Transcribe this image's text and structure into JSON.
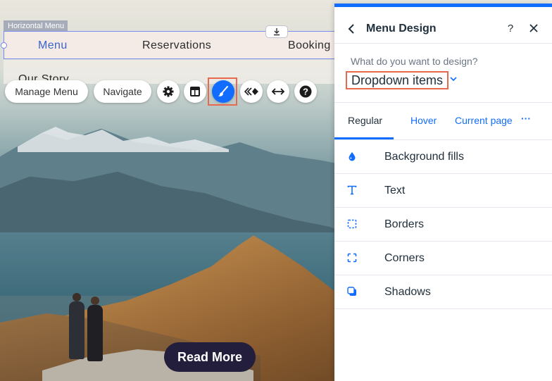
{
  "canvas": {
    "menu_tag": "Horizontal Menu",
    "menu_items": [
      {
        "label": "Menu",
        "active": true
      },
      {
        "label": "Reservations",
        "active": false
      },
      {
        "label": "Booking",
        "active": false
      }
    ],
    "sub_item": "Our Story",
    "read_more": "Read More"
  },
  "toolbar": {
    "manage_menu": "Manage Menu",
    "navigate": "Navigate",
    "icons": [
      "gear-icon",
      "layout-icon",
      "paintbrush-icon",
      "animation-icon",
      "stretch-icon",
      "help-icon"
    ],
    "active_icon": "paintbrush-icon"
  },
  "panel": {
    "title": "Menu Design",
    "help": "?",
    "close": "✕",
    "back": "‹",
    "question": "What do you want to design?",
    "selected": "Dropdown items",
    "tabs": [
      "Regular",
      "Hover",
      "Current page",
      "···"
    ],
    "selected_tab": "Regular",
    "options": [
      {
        "label": "Background fills",
        "icon": "droplet-icon"
      },
      {
        "label": "Text",
        "icon": "text-icon"
      },
      {
        "label": "Borders",
        "icon": "border-icon"
      },
      {
        "label": "Corners",
        "icon": "corners-icon"
      },
      {
        "label": "Shadows",
        "icon": "shadow-icon"
      }
    ]
  },
  "colors": {
    "accent": "#116dff",
    "highlight": "#e8694e",
    "read_more_bg": "#231e3c"
  }
}
